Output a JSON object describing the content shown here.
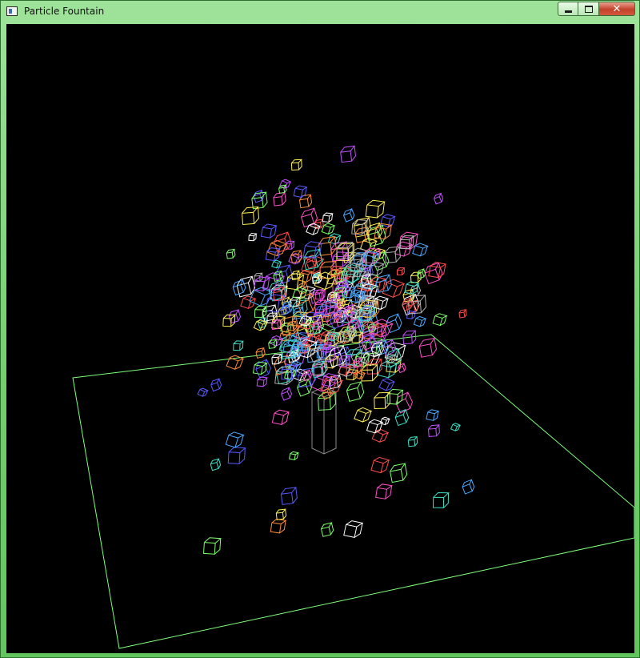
{
  "window": {
    "title": "Particle Fountain",
    "background": "#000000",
    "floor_color": "#7cff7c",
    "emitter_color": "#8a8a8a",
    "particle_colors": [
      "#ffffff",
      "#ff4d4d",
      "#ff8c3a",
      "#ffee55",
      "#7dff6a",
      "#3de0c8",
      "#4aa8ff",
      "#5a5aff",
      "#c050ff",
      "#ff50c8",
      "#b0b0b0"
    ]
  }
}
